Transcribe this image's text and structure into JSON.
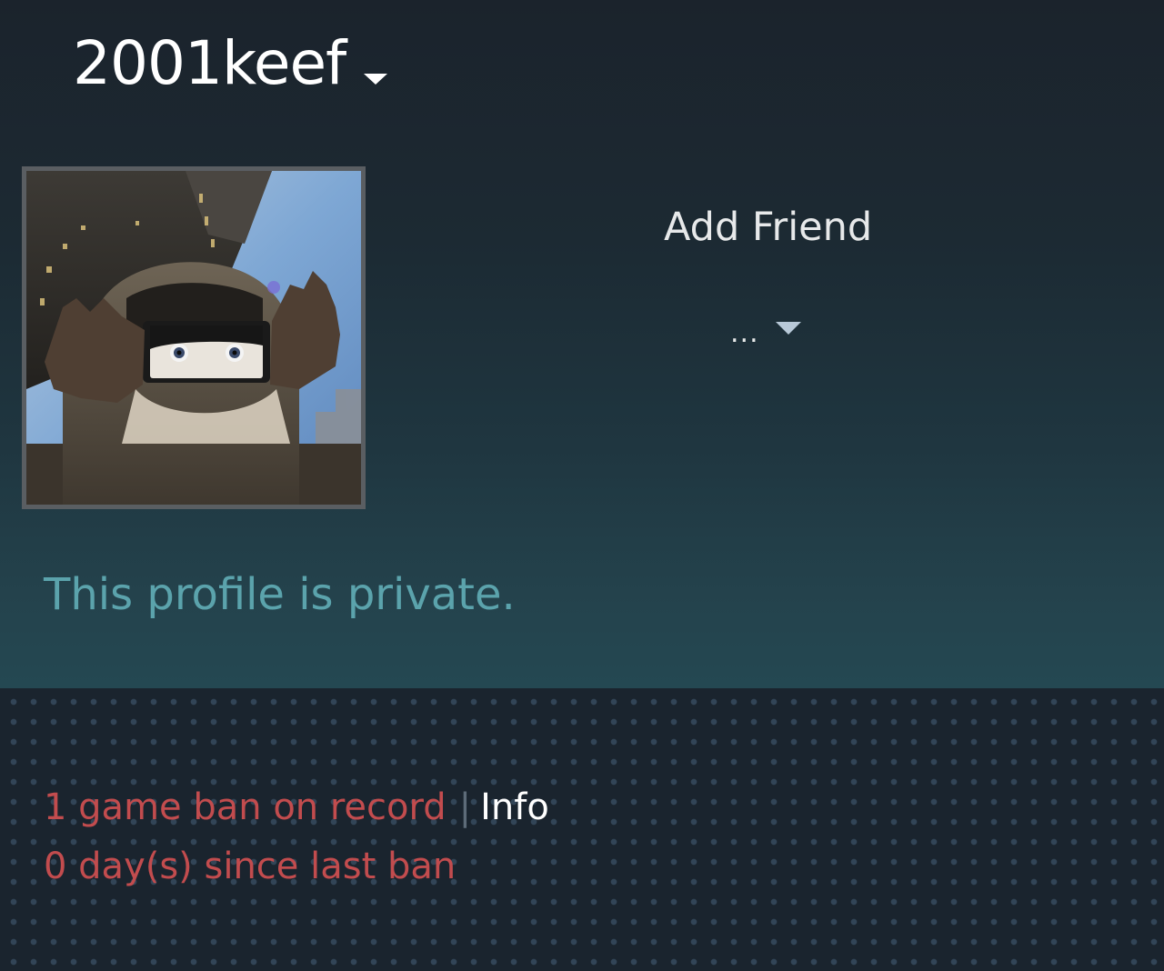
{
  "profile": {
    "persona_name": "2001keef",
    "avatar_alt": "profile avatar"
  },
  "actions": {
    "add_friend_label": "Add Friend",
    "more_label": "..."
  },
  "privacy": {
    "message": "This profile is private."
  },
  "bans": {
    "game_ban_text": "1 game ban on record",
    "separator": "|",
    "info_link": "Info",
    "days_since_text": "0 day(s) since last ban"
  },
  "colors": {
    "ban_red": "#c24c4e",
    "private_teal": "#5ba3ac",
    "text_light": "#e7e9ea"
  }
}
